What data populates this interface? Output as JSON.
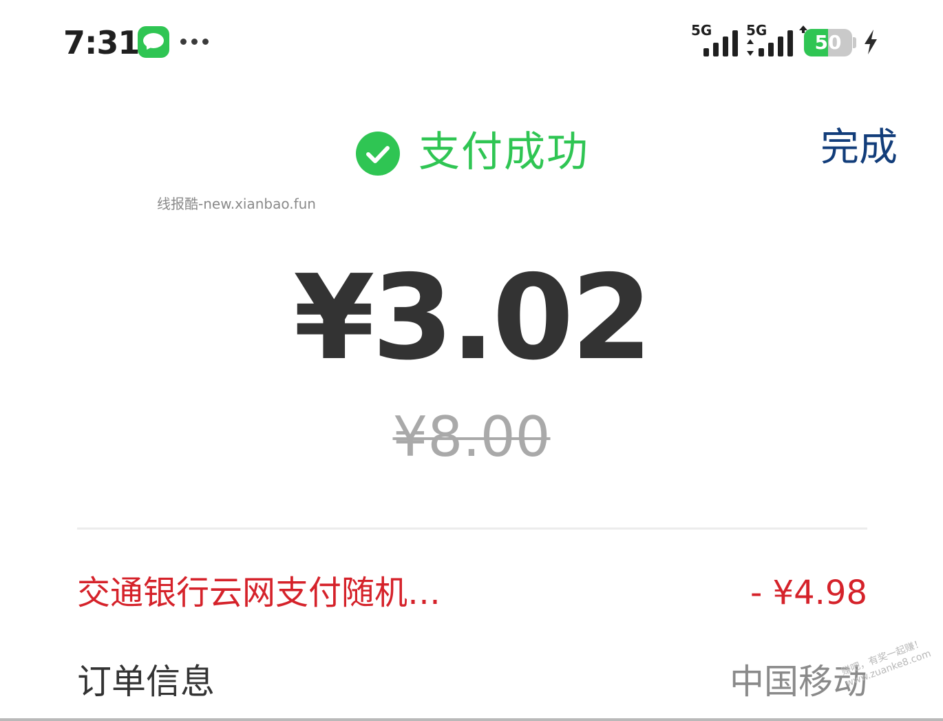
{
  "status_bar": {
    "time": "7:31",
    "signal_1_label": "5G",
    "signal_2_label": "5G",
    "battery_level": "50",
    "battery_fraction": 0.5
  },
  "header": {
    "status_text": "支付成功",
    "done_label": "完成"
  },
  "watermark": {
    "top": "线报酷-new.xianbao.fun",
    "corner_line1": "赚吧，有奖一起赚！",
    "corner_line2": "www.zuanke8.com"
  },
  "payment": {
    "amount": "¥3.02",
    "original_amount": "¥8.00"
  },
  "discount": {
    "label": "交通银行云网支付随机…",
    "value": "- ¥4.98"
  },
  "order": {
    "label": "订单信息",
    "merchant": "中国移动"
  },
  "colors": {
    "success_green": "#2fc553",
    "done_blue": "#123d7a",
    "discount_red": "#d5222a"
  },
  "icons": {
    "messages": "messages-icon",
    "more": "more-dots-icon",
    "signal": "signal-icon",
    "battery": "battery-icon",
    "charging": "charging-bolt-icon",
    "success": "check-circle-icon"
  }
}
